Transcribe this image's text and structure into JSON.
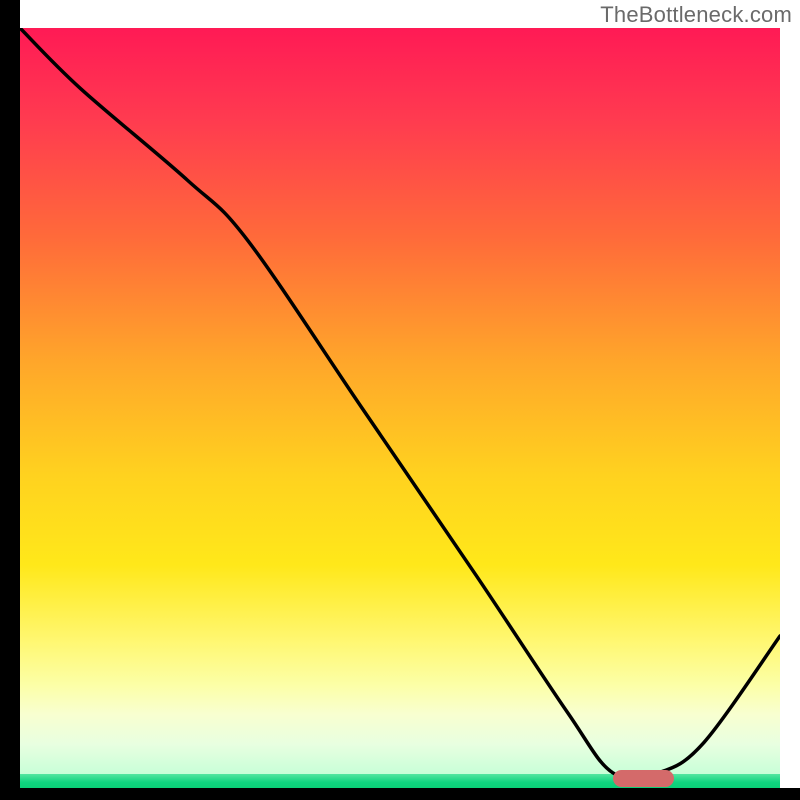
{
  "watermark": "TheBottleneck.com",
  "chart_data": {
    "type": "line",
    "title": "",
    "xlabel": "",
    "ylabel": "",
    "xlim": [
      0,
      100
    ],
    "ylim": [
      0,
      100
    ],
    "series": [
      {
        "name": "bottleneck-curve",
        "x": [
          0,
          8,
          22,
          30,
          45,
          60,
          72,
          78,
          84,
          90,
          100
        ],
        "y": [
          100,
          92,
          80,
          72,
          50,
          28,
          10,
          2,
          2,
          6,
          20
        ]
      }
    ],
    "optimal_marker": {
      "x_start": 78,
      "x_end": 86,
      "y": 1.3
    },
    "gradient_stops": [
      {
        "pos": 0,
        "color": "#ff1a55"
      },
      {
        "pos": 28,
        "color": "#ff6a3a"
      },
      {
        "pos": 60,
        "color": "#ffd21f"
      },
      {
        "pos": 88,
        "color": "#fcffa6"
      },
      {
        "pos": 100,
        "color": "#0bd077"
      }
    ]
  }
}
